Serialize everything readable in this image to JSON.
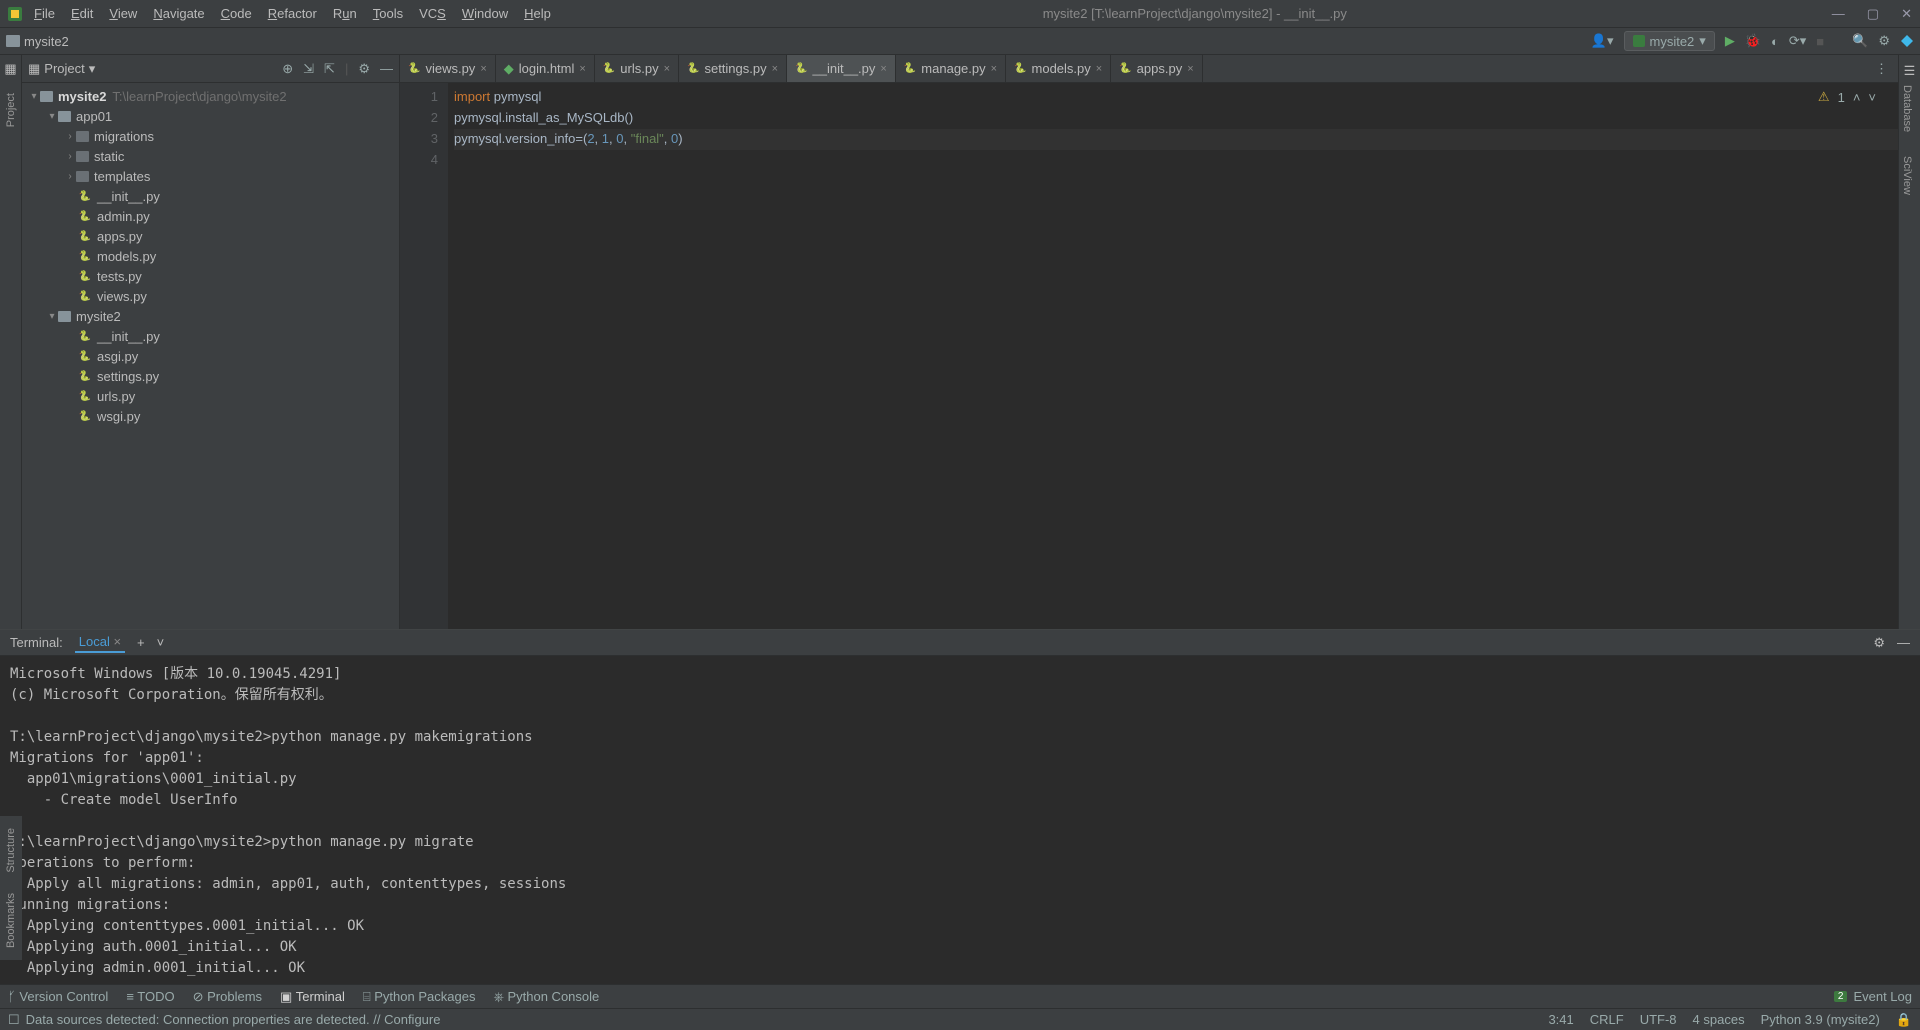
{
  "window": {
    "title": "mysite2 [T:\\learnProject\\django\\mysite2] - __init__.py"
  },
  "menu": [
    "File",
    "Edit",
    "View",
    "Navigate",
    "Code",
    "Refactor",
    "Run",
    "Tools",
    "VCS",
    "Window",
    "Help"
  ],
  "breadcrumb": "mysite2",
  "run_config": "mysite2",
  "project": {
    "title": "Project",
    "root": {
      "name": "mysite2",
      "path": "T:\\learnProject\\django\\mysite2"
    },
    "app01": {
      "name": "app01",
      "dirs": [
        "migrations",
        "static",
        "templates"
      ],
      "files": [
        "__init__.py",
        "admin.py",
        "apps.py",
        "models.py",
        "tests.py",
        "views.py"
      ]
    },
    "pkg": {
      "name": "mysite2",
      "files": [
        "__init__.py",
        "asgi.py",
        "settings.py",
        "urls.py",
        "wsgi.py"
      ]
    }
  },
  "tabs": [
    {
      "label": "views.py",
      "icon": "py",
      "active": false
    },
    {
      "label": "login.html",
      "icon": "html",
      "active": false
    },
    {
      "label": "urls.py",
      "icon": "py",
      "active": false
    },
    {
      "label": "settings.py",
      "icon": "py",
      "active": false
    },
    {
      "label": "__init__.py",
      "icon": "py",
      "active": true
    },
    {
      "label": "manage.py",
      "icon": "py",
      "active": false
    },
    {
      "label": "models.py",
      "icon": "py",
      "active": false
    },
    {
      "label": "apps.py",
      "icon": "py",
      "active": false
    }
  ],
  "editor": {
    "line1": {
      "import": "import",
      "mod": " pymysql"
    },
    "line2": "pymysql.install_as_MySQLdb()",
    "line3": {
      "pre": "pymysql.version_info=(",
      "n1": "2",
      "c": ", ",
      "n2": "1",
      "n3": "0",
      "s": "\"final\"",
      "n4": "0",
      "post": ")"
    },
    "warnings": "1"
  },
  "terminal": {
    "label": "Terminal:",
    "tab": "Local",
    "output": "Microsoft Windows [版本 10.0.19045.4291]\n(c) Microsoft Corporation。保留所有权利。\n\nT:\\learnProject\\django\\mysite2>python manage.py makemigrations\nMigrations for 'app01':\n  app01\\migrations\\0001_initial.py\n    - Create model UserInfo\n\nT:\\learnProject\\django\\mysite2>python manage.py migrate\nOperations to perform:\n  Apply all migrations: admin, app01, auth, contenttypes, sessions\nRunning migrations:\n  Applying contenttypes.0001_initial... OK\n  Applying auth.0001_initial... OK\n  Applying admin.0001_initial... OK"
  },
  "bottom_tools": [
    "Version Control",
    "TODO",
    "Problems",
    "Terminal",
    "Python Packages",
    "Python Console"
  ],
  "status": {
    "left": "Data sources detected: Connection properties are detected. // Configure",
    "pos": "3:41",
    "crlf": "CRLF",
    "enc": "UTF-8",
    "indent": "4 spaces",
    "py": "Python 3.9 (mysite2)",
    "event": "Event Log",
    "badge": "2"
  },
  "side_labels": {
    "project": "Project",
    "structure": "Structure",
    "bookmarks": "Bookmarks",
    "database": "Database",
    "sciview": "SciView"
  }
}
